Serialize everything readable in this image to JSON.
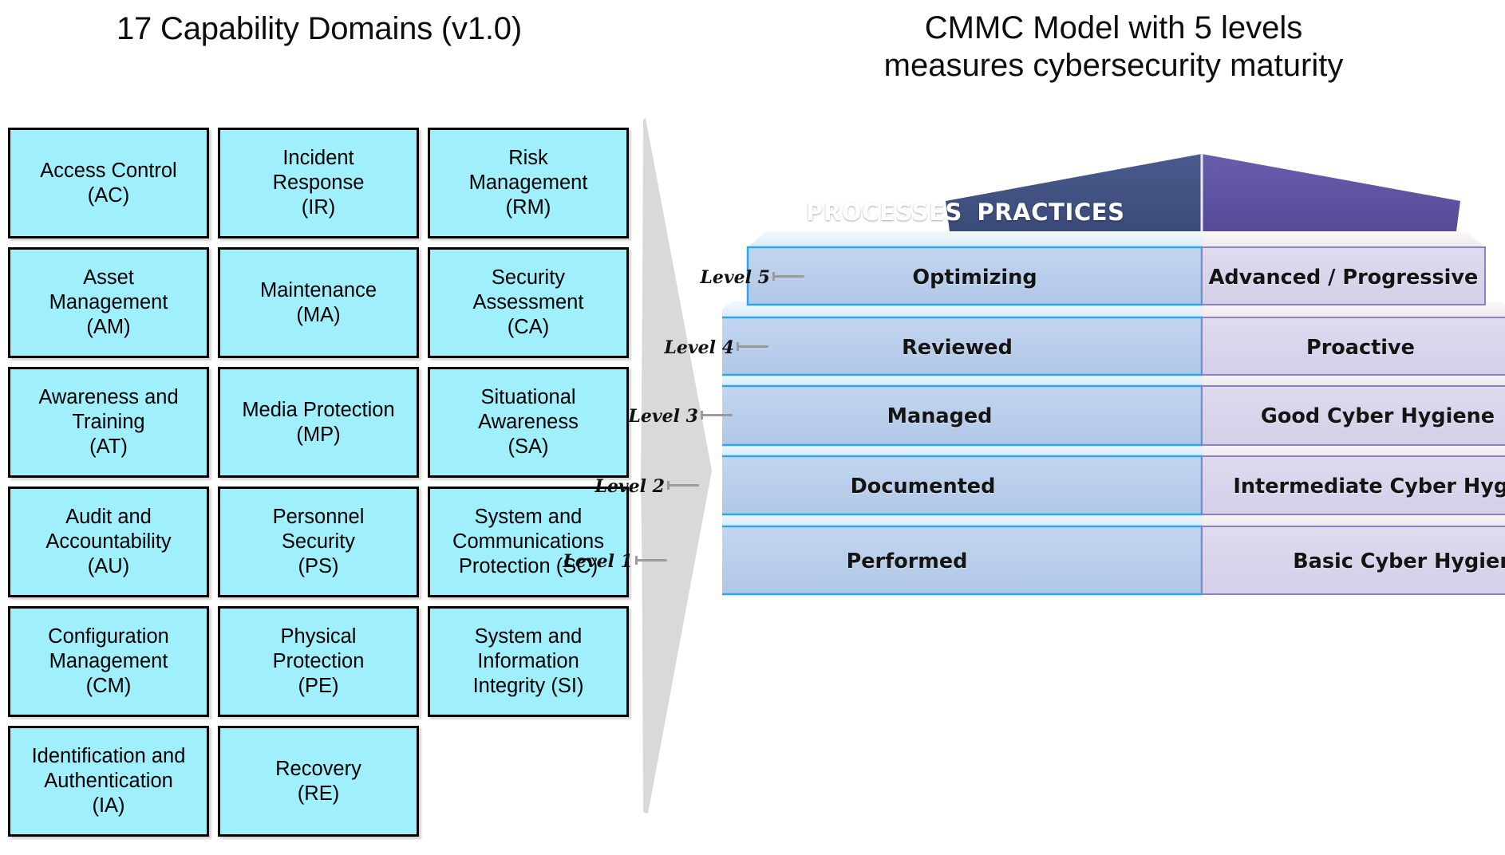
{
  "left": {
    "title": "17 Capability Domains (v1.0)",
    "domains": [
      {
        "name": "Access Control",
        "abbr": "(AC)",
        "label": "Access Control\n(AC)"
      },
      {
        "name": "Incident Response",
        "abbr": "(IR)",
        "label": "Incident\nResponse\n(IR)"
      },
      {
        "name": "Risk Management",
        "abbr": "(RM)",
        "label": "Risk\nManagement\n(RM)"
      },
      {
        "name": "Asset Management",
        "abbr": "(AM)",
        "label": "Asset\nManagement\n(AM)"
      },
      {
        "name": "Maintenance",
        "abbr": "(MA)",
        "label": "Maintenance\n(MA)"
      },
      {
        "name": "Security Assessment",
        "abbr": "(CA)",
        "label": "Security\nAssessment\n(CA)"
      },
      {
        "name": "Awareness and Training",
        "abbr": "(AT)",
        "label": "Awareness and\nTraining\n(AT)"
      },
      {
        "name": "Media Protection",
        "abbr": "(MP)",
        "label": "Media Protection\n(MP)"
      },
      {
        "name": "Situational Awareness",
        "abbr": "(SA)",
        "label": "Situational\nAwareness\n(SA)"
      },
      {
        "name": "Audit and Accountability",
        "abbr": "(AU)",
        "label": "Audit and\nAccountability\n(AU)"
      },
      {
        "name": "Personnel Security",
        "abbr": "(PS)",
        "label": "Personnel\nSecurity\n(PS)"
      },
      {
        "name": "System and Communications Protection",
        "abbr": "(SC)",
        "label": "System and\nCommunications\nProtection (SC)"
      },
      {
        "name": "Configuration Management",
        "abbr": "(CM)",
        "label": "Configuration\nManagement\n(CM)"
      },
      {
        "name": "Physical Protection",
        "abbr": "(PE)",
        "label": "Physical\nProtection\n(PE)"
      },
      {
        "name": "System and Information Integrity",
        "abbr": "(SI)",
        "label": "System and\nInformation\nIntegrity (SI)"
      },
      {
        "name": "Identification and Authentication",
        "abbr": "(IA)",
        "label": "Identification and\nAuthentication\n(IA)"
      },
      {
        "name": "Recovery",
        "abbr": "(RE)",
        "label": "Recovery\n(RE)"
      }
    ],
    "box_fill": "#9ff0fc",
    "box_border": "#000000"
  },
  "divider": {
    "icon": "right-arrow-chevron",
    "color": "#d9d9d9"
  },
  "right": {
    "title": "CMMC Model with 5 levels\nmeasures cybersecurity maturity",
    "roof": {
      "left_label": "PROCESSES",
      "right_label": "PRACTICES",
      "left_color": "#3f4e80",
      "right_color": "#5b4f9e"
    },
    "levels": [
      {
        "tag": "Level 5",
        "process": "Optimizing",
        "practice": "Advanced / Progressive"
      },
      {
        "tag": "Level 4",
        "process": "Reviewed",
        "practice": "Proactive"
      },
      {
        "tag": "Level 3",
        "process": "Managed",
        "practice": "Good Cyber Hygiene"
      },
      {
        "tag": "Level 2",
        "process": "Documented",
        "practice": "Intermediate Cyber Hygiene"
      },
      {
        "tag": "Level 1",
        "process": "Performed",
        "practice": "Basic Cyber Hygiene"
      }
    ],
    "colors": {
      "process_fill": "#b6cdeb",
      "process_edge": "#29a8ea",
      "practice_fill": "#d8d5ec",
      "practice_edge": "#8b82bf",
      "process_top": "#e2eff9",
      "practice_top": "#f3eef1"
    }
  }
}
